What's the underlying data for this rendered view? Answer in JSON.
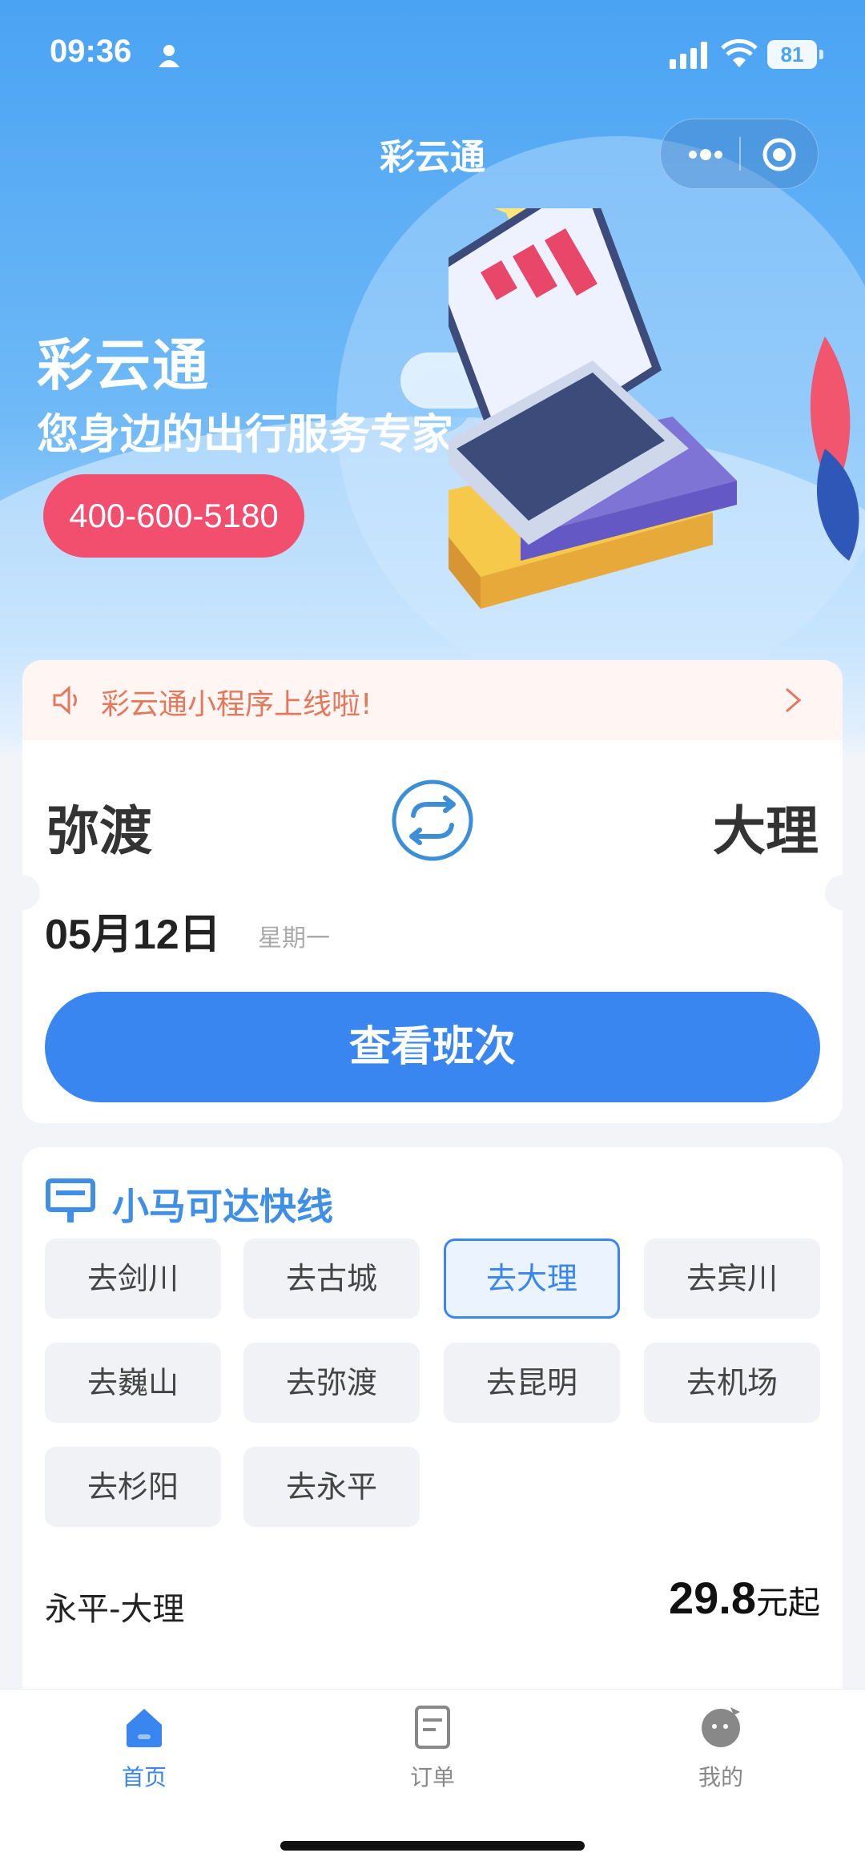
{
  "status_bar": {
    "time": "09:36",
    "battery": "81"
  },
  "header": {
    "title": "彩云通"
  },
  "banner": {
    "brand": "彩云通",
    "slogan": "您身边的出行服务专家",
    "phone": "400-600-5180"
  },
  "notice": {
    "text": "彩云通小程序上线啦!"
  },
  "booking": {
    "from": "弥渡",
    "to": "大理",
    "date": "05月12日",
    "weekday": "星期一",
    "search_label": "查看班次"
  },
  "express": {
    "title": "小马可达快线",
    "destinations": [
      "去剑川",
      "去古城",
      "去大理",
      "去宾川",
      "去巍山",
      "去弥渡",
      "去昆明",
      "去机场",
      "去杉阳",
      "去永平"
    ],
    "selected": "去大理",
    "route": "永平-大理",
    "price": "29.8",
    "price_unit": "元起"
  },
  "tabbar": {
    "home": "首页",
    "orders": "订单",
    "mine": "我的"
  },
  "colors": {
    "primary": "#3a86f0",
    "phone_badge": "#f24e6d",
    "notice_text": "#e4785c",
    "section_title": "#3f8fe6"
  }
}
